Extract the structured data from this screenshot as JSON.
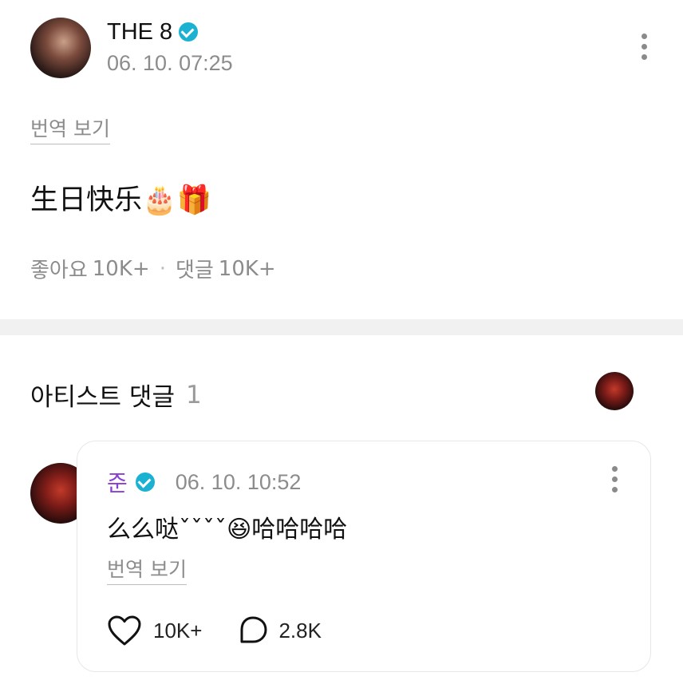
{
  "post": {
    "author": "THE 8",
    "timestamp": "06. 10. 07:25",
    "translate_label": "번역 보기",
    "body_text": "生日快乐",
    "emojis": "🎂🎁",
    "likes_label": "좋아요",
    "likes_count": "10K+",
    "separator": "·",
    "comments_label": "댓글",
    "comments_count": "10K+"
  },
  "artist_comments": {
    "title": "아티스트 댓글",
    "count": "1"
  },
  "comment": {
    "author": "준",
    "author_color": "#8b3fd1",
    "timestamp": "06. 10. 10:52",
    "text": "么么哒ˇˇˇˇ",
    "emoji": "😆",
    "text_after": "哈哈哈哈",
    "translate_label": "번역 보기",
    "like_count": "10K+",
    "reply_count": "2.8K"
  },
  "colors": {
    "verified": "#1ab1d2",
    "meta_gray": "#8c8c8c",
    "divider": "#f1f1f1"
  },
  "icons": [
    "verified-icon",
    "more-icon",
    "heart-icon",
    "comment-icon"
  ]
}
